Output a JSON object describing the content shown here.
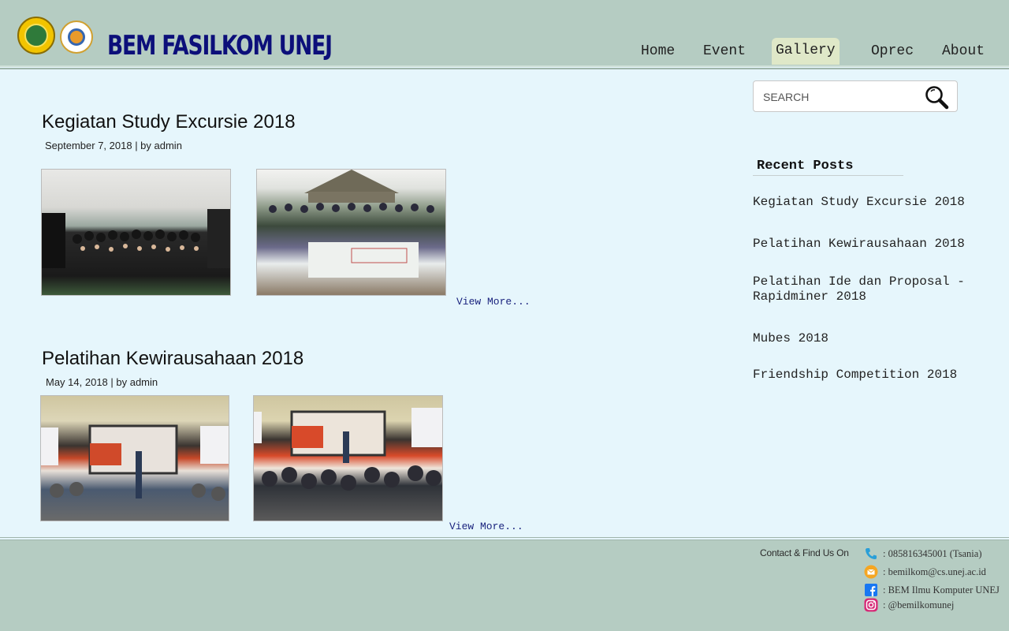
{
  "header": {
    "brand": "BEM FASILKOM UNEJ",
    "logos": [
      "university-logo",
      "faculty-logo"
    ]
  },
  "nav": {
    "items": [
      {
        "label": "Home",
        "active": false
      },
      {
        "label": "Event",
        "active": false
      },
      {
        "label": "Gallery",
        "active": true
      },
      {
        "label": "Oprec",
        "active": false
      },
      {
        "label": "About",
        "active": false
      }
    ]
  },
  "posts": [
    {
      "title": "Kegiatan Study Excursie 2018",
      "meta": "September 7, 2018 | by admin",
      "view_more": "View More..."
    },
    {
      "title": "Pelatihan Kewirausahaan 2018",
      "meta": "May 14, 2018 | by admin",
      "view_more": "View More..."
    }
  ],
  "sidebar": {
    "search_placeholder": "SEARCH",
    "recent_title": "Recent Posts",
    "recent_posts": [
      "Kegiatan Study Excursie 2018",
      "Pelatihan Kewirausahaan 2018",
      "Pelatihan Ide dan Proposal - Rapidminer 2018",
      "Mubes 2018",
      "Friendship Competition 2018"
    ]
  },
  "footer": {
    "contact_label": "Contact & Find Us On",
    "contacts": [
      {
        "icon": "phone-icon",
        "text": ": 085816345001 (Tsania)",
        "color": "#2a9fd8"
      },
      {
        "icon": "mail-icon",
        "text": ": bemilkom@cs.unej.ac.id",
        "color": "#f5a623"
      },
      {
        "icon": "facebook-icon",
        "text": ": BEM Ilmu Komputer UNEJ",
        "color": "#1877f2"
      },
      {
        "icon": "instagram-icon",
        "text": ": @bemilkomunej",
        "color": "#d62976"
      }
    ]
  },
  "colors": {
    "header_bg": "#b5ccc2",
    "page_bg": "#e6f6fc",
    "brand": "#0c0f7a",
    "nav_active_bg": "#dfe8c8",
    "link": "#1a237e"
  }
}
